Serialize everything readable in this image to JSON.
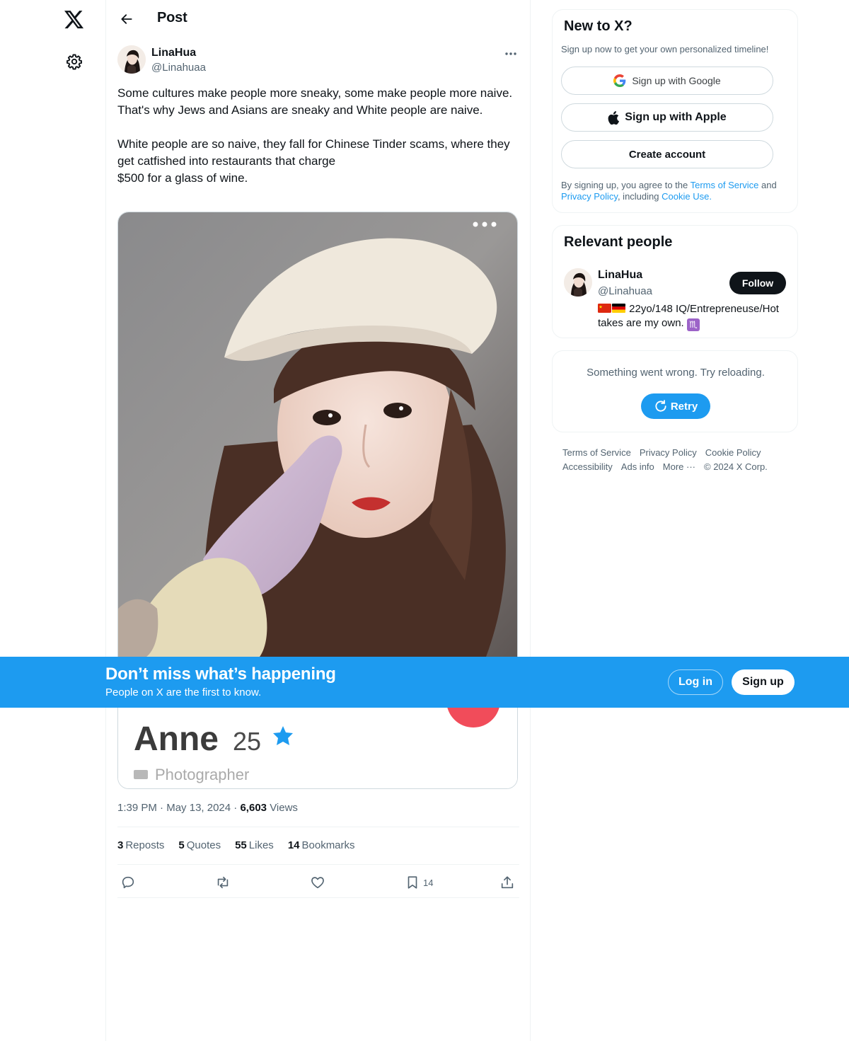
{
  "nav": {
    "logo_icon": "x-logo-icon",
    "settings_icon": "gear-icon"
  },
  "header": {
    "title": "Post",
    "back_icon": "arrow-left-icon"
  },
  "post": {
    "author_name": "LinaHua",
    "author_handle": "@Linahuaa",
    "text_lines": [
      "Some cultures make people more sneaky, some make people more naive.\nThat's why Jews and Asians are sneaky and White people are naive.",
      "White people are so naive, they fall for Chinese Tinder scams, where they get catfished into restaurants that charge\n$500 for a glass of wine."
    ],
    "media": {
      "profile_name": "Anne",
      "profile_age": "25",
      "profile_job": "Photographer"
    },
    "time": "1:39 PM",
    "date": "May 13, 2024",
    "views_count": "6,603",
    "views_label": "Views",
    "stats": {
      "reposts_count": "3",
      "reposts_label": "Reposts",
      "quotes_count": "5",
      "quotes_label": "Quotes",
      "likes_count": "55",
      "likes_label": "Likes",
      "bookmarks_count": "14",
      "bookmarks_label": "Bookmarks"
    },
    "actions": {
      "bookmark_count": "14"
    }
  },
  "sidebar": {
    "new_to_x": {
      "title": "New to X?",
      "subtitle": "Sign up now to get your own personalized timeline!",
      "google_label": "Sign up with Google",
      "apple_label": "Sign up with Apple",
      "create_label": "Create account",
      "legal_prefix": "By signing up, you agree to the ",
      "terms_link": "Terms of Service",
      "legal_and": " and ",
      "privacy_link": "Privacy Policy",
      "legal_including": ", including ",
      "cookie_link": "Cookie Use",
      "legal_end": "."
    },
    "relevant_people": {
      "title": "Relevant people",
      "name": "LinaHua",
      "handle": "@Linahuaa",
      "follow_label": "Follow",
      "bio_text": " 22yo/148 IQ/Entrepreneuse/Hot takes are my own. ",
      "bio_emoji": "♏"
    },
    "error": {
      "text": "Something went wrong. Try reloading.",
      "retry_label": "Retry"
    },
    "footer": {
      "terms": "Terms of Service",
      "privacy": "Privacy Policy",
      "cookie": "Cookie Policy",
      "accessibility": "Accessibility",
      "ads": "Ads info",
      "more": "More ···",
      "copyright": "© 2024 X Corp."
    }
  },
  "banner": {
    "title": "Don’t miss what’s happening",
    "subtitle": "People on X are the first to know.",
    "login_label": "Log in",
    "signup_label": "Sign up"
  },
  "colors": {
    "accent": "#1d9bf0",
    "text": "#0f1419",
    "secondary": "#536471",
    "border": "#eff3f4"
  }
}
